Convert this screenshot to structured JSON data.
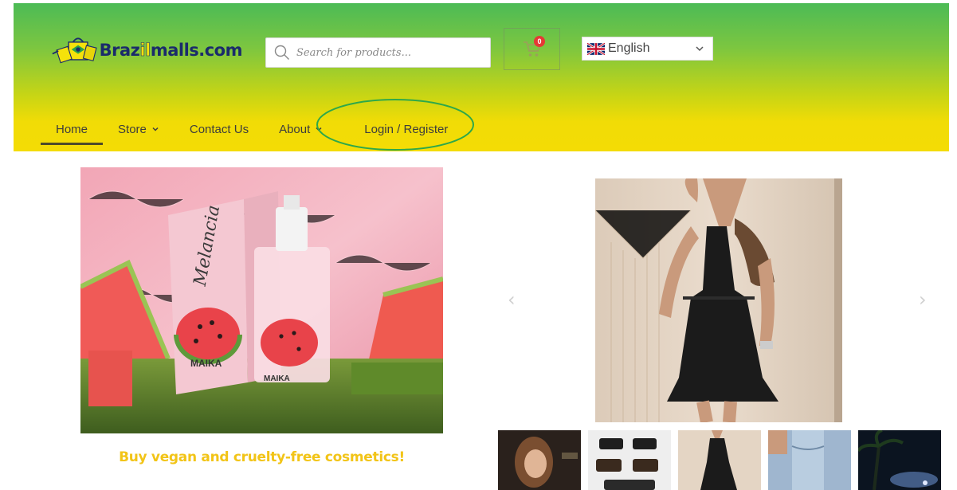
{
  "header": {
    "logo": {
      "text_main": "Braz",
      "text_highlight": "il",
      "text_end": "malls.com"
    },
    "search": {
      "placeholder": "Search for products..."
    },
    "cart": {
      "count": "0"
    },
    "language": {
      "selected": "English"
    }
  },
  "nav": {
    "items": [
      {
        "label": "Home"
      },
      {
        "label": "Store"
      },
      {
        "label": "Contact Us"
      },
      {
        "label": "About"
      },
      {
        "label": "Login / Register"
      }
    ]
  },
  "promo": {
    "caption": "Buy vegan and cruelty-free cosmetics!",
    "product_brand": "MAIKA",
    "product_name": "Melancia"
  },
  "slider": {
    "prev_arrow": "‹",
    "next_arrow": "›"
  },
  "colors": {
    "header_top": "#4cbb56",
    "header_bottom": "#f4dc05",
    "logo_navy": "#1a2b6b",
    "caption_yellow": "#f2c417",
    "badge_red": "#e53935",
    "annotation_green": "#2ea84a"
  }
}
